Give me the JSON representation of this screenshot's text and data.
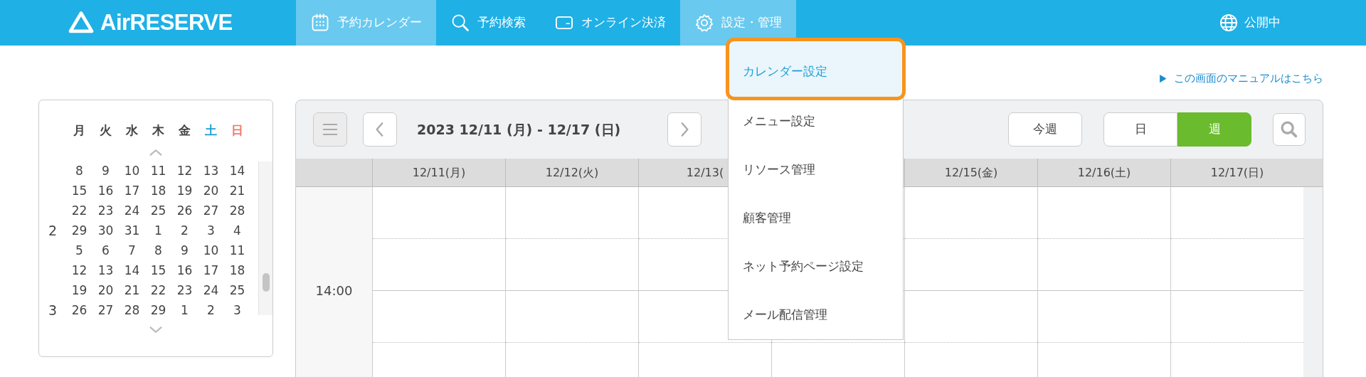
{
  "header": {
    "logo": "AirRESERVE",
    "nav": [
      {
        "label": "予約カレンダー",
        "selected": true,
        "expanded": false
      },
      {
        "label": "予約検索",
        "selected": false,
        "expanded": false
      },
      {
        "label": "オンライン決済",
        "selected": false,
        "expanded": false
      },
      {
        "label": "設定・管理",
        "selected": false,
        "expanded": true
      }
    ],
    "status": "公開中"
  },
  "settings_menu": [
    {
      "label": "カレンダー設定",
      "selected": true
    },
    {
      "label": "メニュー設定",
      "selected": false
    },
    {
      "label": "リソース管理",
      "selected": false
    },
    {
      "label": "顧客管理",
      "selected": false
    },
    {
      "label": "ネット予約ページ設定",
      "selected": false
    },
    {
      "label": "メール配信管理",
      "selected": false
    }
  ],
  "manual_link": "この画面のマニュアルはこちら",
  "mini_calendar": {
    "weekdays": [
      {
        "label": "月",
        "color": "#444444"
      },
      {
        "label": "火",
        "color": "#444444"
      },
      {
        "label": "水",
        "color": "#444444"
      },
      {
        "label": "木",
        "color": "#444444"
      },
      {
        "label": "金",
        "color": "#444444"
      },
      {
        "label": "土",
        "color": "#1a9fd9"
      },
      {
        "label": "日",
        "color": "#f0786a"
      }
    ],
    "weeks": [
      {
        "days": [
          "8",
          "9",
          "10",
          "11",
          "12",
          "13",
          "14"
        ]
      },
      {
        "days": [
          "15",
          "16",
          "17",
          "18",
          "19",
          "20",
          "21"
        ]
      },
      {
        "days": [
          "22",
          "23",
          "24",
          "25",
          "26",
          "27",
          "28"
        ]
      },
      {
        "month": "2",
        "days": [
          "29",
          "30",
          "31",
          "1",
          "2",
          "3",
          "4"
        ]
      },
      {
        "days": [
          "5",
          "6",
          "7",
          "8",
          "9",
          "10",
          "11"
        ]
      },
      {
        "days": [
          "12",
          "13",
          "14",
          "15",
          "16",
          "17",
          "18"
        ]
      },
      {
        "days": [
          "19",
          "20",
          "21",
          "22",
          "23",
          "24",
          "25"
        ]
      },
      {
        "month": "3",
        "days": [
          "26",
          "27",
          "28",
          "29",
          "1",
          "2",
          "3"
        ]
      }
    ]
  },
  "calendar": {
    "range": "2023 12/11 (月) - 12/17 (日)",
    "today_button": "今週",
    "views": [
      {
        "label": "日",
        "selected": false
      },
      {
        "label": "週",
        "selected": true
      }
    ],
    "columns": [
      {
        "label": "12/11(月)"
      },
      {
        "label": "12/12(火)"
      },
      {
        "label": "12/13("
      },
      {},
      {
        "label": "12/15(金)"
      },
      {
        "label": "12/16(土)"
      },
      {
        "label": "12/17(日)"
      }
    ],
    "times": [
      "14:00"
    ]
  }
}
